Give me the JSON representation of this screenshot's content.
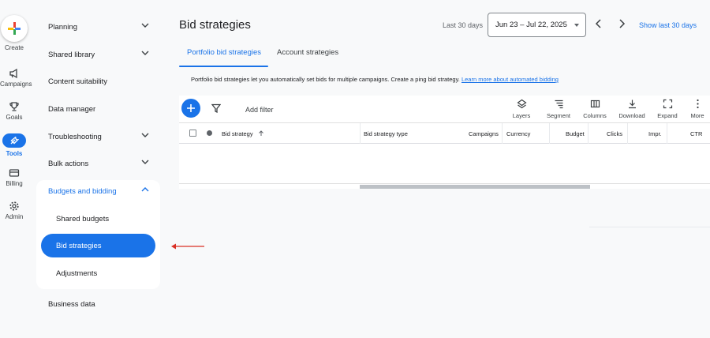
{
  "rail": {
    "create": "Create",
    "campaigns": "Campaigns",
    "goals": "Goals",
    "tools": "Tools",
    "billing": "Billing",
    "admin": "Admin"
  },
  "nav": {
    "planning": "Planning",
    "shared_library": "Shared library",
    "content_suitability": "Content suitability",
    "data_manager": "Data manager",
    "troubleshooting": "Troubleshooting",
    "bulk_actions": "Bulk actions",
    "budgets_and_bidding": "Budgets and bidding",
    "shared_budgets": "Shared budgets",
    "bid_strategies": "Bid strategies",
    "adjustments": "Adjustments",
    "business_data": "Business data"
  },
  "header": {
    "title": "Bid strategies",
    "date_label": "Last 30 days",
    "date_range": "Jun 23 – Jul 22, 2025",
    "show_last": "Show last 30 days"
  },
  "tabs": [
    {
      "label": "Portfolio bid strategies"
    },
    {
      "label": "Account strategies"
    }
  ],
  "info": {
    "text": "Portfolio bid strategies let you automatically set bids for multiple campaigns. Create a p",
    "text2": "ing bid strategy.",
    "link": "Learn more about automated bidding"
  },
  "toolbar": {
    "add_filter": "Add filter",
    "layers": "Layers",
    "segment": "Segment",
    "columns": "Columns",
    "download": "Download",
    "expand": "Expand",
    "more": "More"
  },
  "table": {
    "columns": [
      "Bid strategy",
      "Bid strategy type",
      "Campaigns",
      "Currency",
      "Budget",
      "Clicks",
      "Impr.",
      "CTR"
    ]
  },
  "colors": {
    "accent": "#1a73e8",
    "arrow": "#d93025"
  }
}
